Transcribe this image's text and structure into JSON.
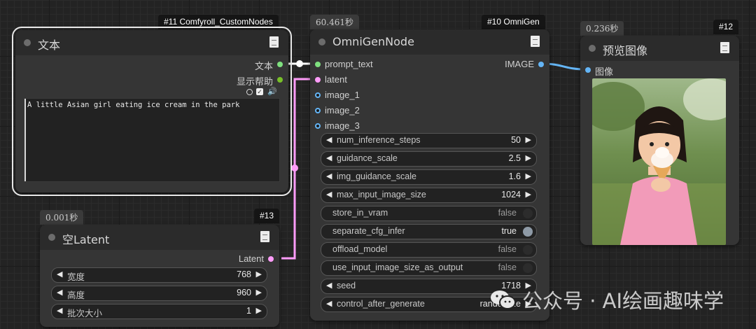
{
  "text_node": {
    "badge": "#11 Comfyroll_CustomNodes",
    "title": "文本",
    "outputs": [
      "文本",
      "显示帮助"
    ],
    "text_value": "A little Asian girl eating ice cream in the park"
  },
  "omnigen_node": {
    "timer": "60.461秒",
    "badge": "#10 OmniGen",
    "title": "OmniGenNode",
    "inputs": [
      "prompt_text",
      "latent",
      "image_1",
      "image_2",
      "image_3"
    ],
    "output": "IMAGE",
    "widgets": [
      {
        "label": "num_inference_steps",
        "value": "50"
      },
      {
        "label": "guidance_scale",
        "value": "2.5"
      },
      {
        "label": "img_guidance_scale",
        "value": "1.6"
      },
      {
        "label": "max_input_image_size",
        "value": "1024"
      }
    ],
    "toggles": [
      {
        "label": "store_in_vram",
        "value": "false"
      },
      {
        "label": "separate_cfg_infer",
        "value": "true"
      },
      {
        "label": "offload_model",
        "value": "false"
      },
      {
        "label": "use_input_image_size_as_output",
        "value": "false"
      }
    ],
    "seed": {
      "label": "seed",
      "value": "1718"
    },
    "control_after_generate": {
      "label": "control_after_generate",
      "value": "randomize"
    }
  },
  "preview_node": {
    "timer": "0.236秒",
    "badge": "#12",
    "title": "预览图像",
    "input": "图像"
  },
  "latent_node": {
    "timer": "0.001秒",
    "badge": "#13",
    "title": "空Latent",
    "output": "Latent",
    "widgets": [
      {
        "label": "宽度",
        "value": "768"
      },
      {
        "label": "高度",
        "value": "960"
      },
      {
        "label": "批次大小",
        "value": "1"
      }
    ]
  },
  "watermark": {
    "text": "公众号 · AI绘画趣味学"
  },
  "colors": {
    "string_slot": "#7fe07f",
    "latent_slot": "#ff9cf9",
    "image_slot": "#64b5f6",
    "help_slot": "#78c028",
    "string_wire": "#ffffff",
    "latent_wire": "#ff9cf9",
    "image_wire": "#64b5f6"
  },
  "icons": {
    "doc": "document-icon",
    "arrow_left": "arrow-left-icon",
    "arrow_right": "arrow-right-icon",
    "wechat": "wechat-icon"
  }
}
